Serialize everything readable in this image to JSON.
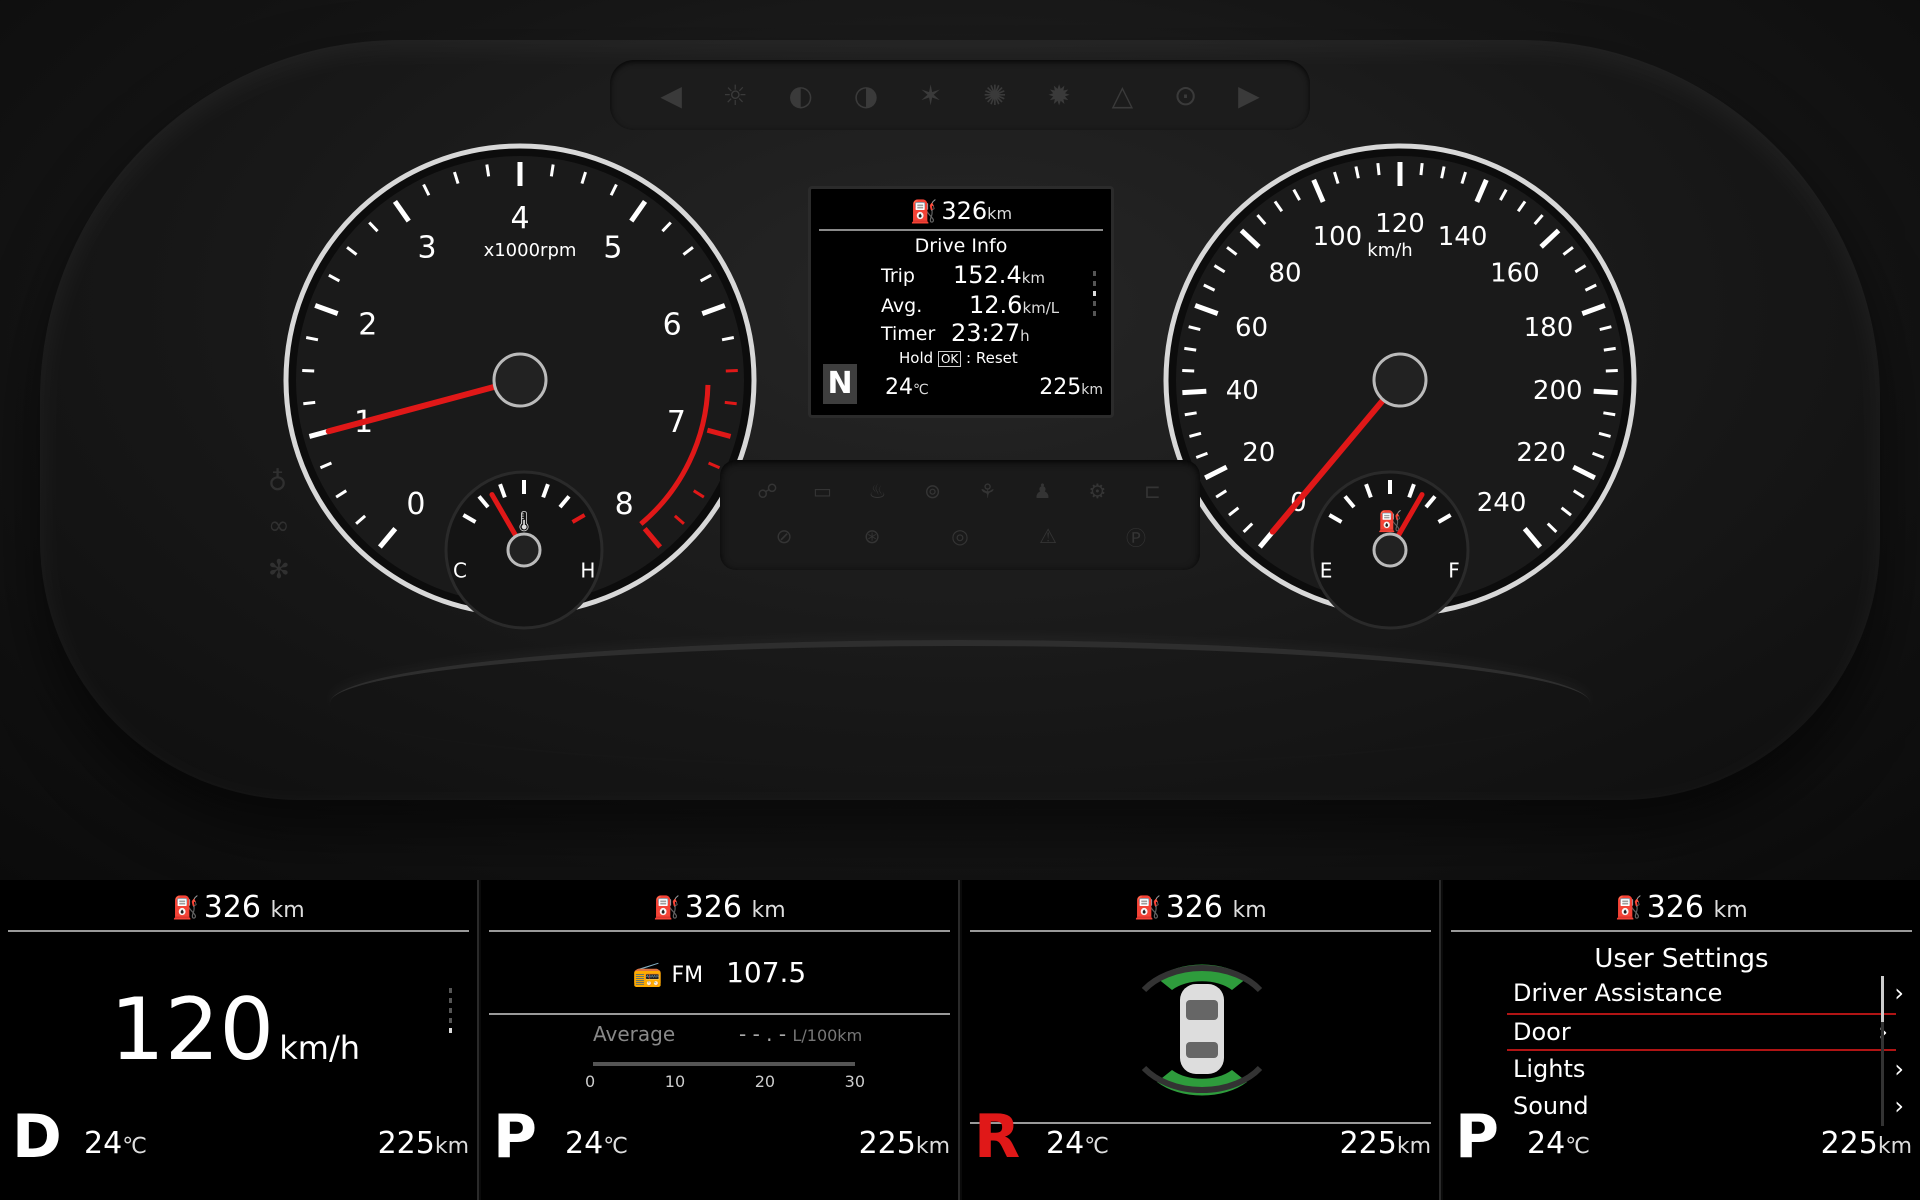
{
  "colors": {
    "accent_red": "#e01818",
    "text": "#ffffff",
    "dim": "#3a3a3a"
  },
  "tachometer": {
    "labels": [
      "0",
      "1",
      "2",
      "3",
      "4",
      "5",
      "6",
      "7",
      "8"
    ],
    "unit": "x1000rpm",
    "needle_value": 1.0,
    "redline_start": 6.5
  },
  "temp_gauge": {
    "low": "C",
    "high": "H",
    "needle_fraction": 0.25
  },
  "speedometer": {
    "labels": [
      "0",
      "20",
      "40",
      "60",
      "80",
      "100",
      "120",
      "140",
      "160",
      "180",
      "200",
      "220",
      "240"
    ],
    "unit": "km/h",
    "needle_value": 0
  },
  "fuel_gauge": {
    "empty": "E",
    "full": "F",
    "needle_fraction": 0.75
  },
  "center_display": {
    "range": "326",
    "range_unit": "km",
    "title": "Drive Info",
    "trip_label": "Trip",
    "trip_value": "152.4",
    "trip_unit": "km",
    "avg_label": "Avg.",
    "avg_value": "12.6",
    "avg_unit": "km/L",
    "timer_label": "Timer",
    "timer_value": "23:27",
    "timer_unit": "h",
    "hold_text": "Hold",
    "ok_text": "OK",
    "reset_text": ": Reset",
    "gear": "N",
    "temp": "24",
    "temp_unit": "℃",
    "distance": "225",
    "distance_unit": "km"
  },
  "panels": [
    {
      "range": "326",
      "range_unit": "km",
      "speed": "120",
      "speed_unit": "km/h",
      "gear": "D",
      "temp": "24",
      "temp_unit": "℃",
      "distance": "225",
      "distance_unit": "km"
    },
    {
      "range": "326",
      "range_unit": "km",
      "radio_band": "FM",
      "radio_freq": "107.5",
      "avg_label": "Average",
      "avg_value": "- - . -",
      "avg_unit": "L/100km",
      "scale": [
        "0",
        "10",
        "20",
        "30"
      ],
      "gear": "P",
      "temp": "24",
      "temp_unit": "℃",
      "distance": "225",
      "distance_unit": "km"
    },
    {
      "range": "326",
      "range_unit": "km",
      "gear": "R",
      "temp": "24",
      "temp_unit": "℃",
      "distance": "225",
      "distance_unit": "km"
    },
    {
      "range": "326",
      "range_unit": "km",
      "title": "User Settings",
      "items": [
        "Driver Assistance",
        "Door",
        "Lights",
        "Sound"
      ],
      "selected": "Door",
      "gear": "P",
      "temp": "24",
      "temp_unit": "℃",
      "distance": "225",
      "distance_unit": "km"
    }
  ]
}
